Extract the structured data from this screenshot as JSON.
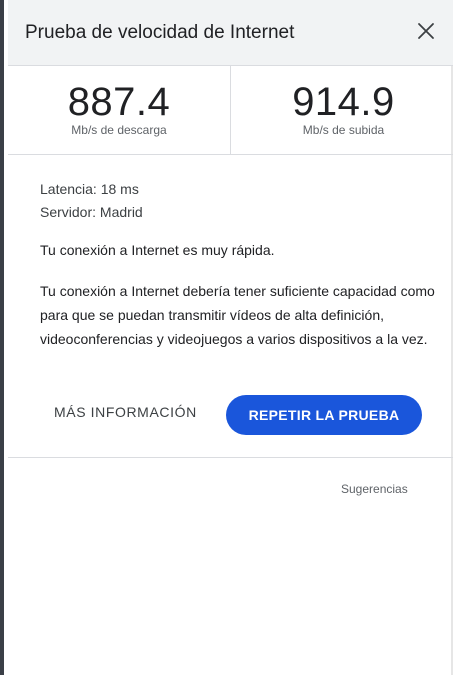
{
  "header": {
    "title": "Prueba de velocidad de Internet",
    "close_icon": "close-icon"
  },
  "speeds": {
    "download": {
      "value": "887.4",
      "unit": "Mb/s de descarga"
    },
    "upload": {
      "value": "914.9",
      "unit": "Mb/s de subida"
    }
  },
  "details": {
    "latency_label": "Latencia:",
    "latency_value": "18 ms",
    "server_label": "Servidor:",
    "server_value": "Madrid"
  },
  "messages": {
    "speed_summary": "Tu conexión a Internet es muy rápida.",
    "capability": "Tu conexión a Internet debería tener suficiente capacidad como para que se puedan transmitir vídeos de alta definición, videoconferencias y videojuegos a varios dispositivos a la vez."
  },
  "actions": {
    "more_info": "MÁS INFORMACIÓN",
    "retry": "REPETIR LA PRUEBA"
  },
  "footer": {
    "suggestions": "Sugerencias"
  },
  "colors": {
    "accent": "#1a56db",
    "header_bg": "#f1f3f4",
    "divider": "#dadce0"
  }
}
